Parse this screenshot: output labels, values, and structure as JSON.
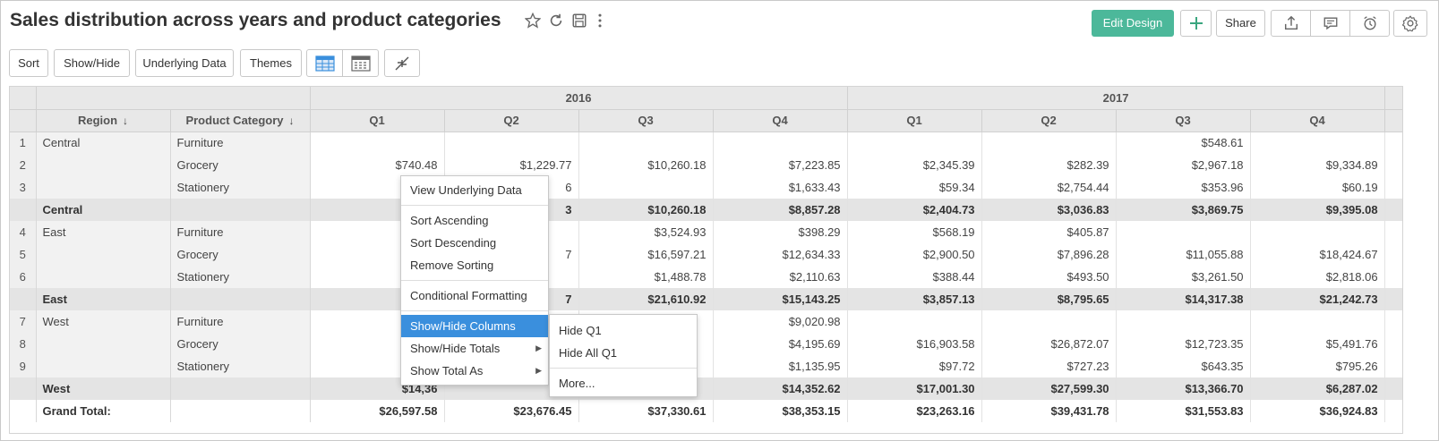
{
  "header": {
    "title": "Sales distribution across years and product categories",
    "edit_design": "Edit Design",
    "share": "Share"
  },
  "toolbar": {
    "sort": "Sort",
    "show_hide": "Show/Hide",
    "underlying_data": "Underlying Data",
    "themes": "Themes"
  },
  "table": {
    "years": [
      "2016",
      "2017"
    ],
    "dim_headers": [
      "Region",
      "Product Category"
    ],
    "quarters": [
      "Q1",
      "Q2",
      "Q3",
      "Q4",
      "Q1",
      "Q2",
      "Q3",
      "Q4"
    ],
    "rows": [
      {
        "idx": "1",
        "region": "Central",
        "category": "Furniture",
        "values": [
          "",
          "",
          "",
          "",
          "",
          "",
          "$548.61",
          ""
        ]
      },
      {
        "idx": "2",
        "region": "",
        "category": "Grocery",
        "values": [
          "$740.48",
          "$1,229.77",
          "$10,260.18",
          "$7,223.85",
          "$2,345.39",
          "$282.39",
          "$2,967.18",
          "$9,334.89"
        ]
      },
      {
        "idx": "3",
        "region": "",
        "category": "Stationery",
        "values": [
          "$79",
          "6",
          "",
          "$1,633.43",
          "$59.34",
          "$2,754.44",
          "$353.96",
          "$60.19"
        ]
      },
      {
        "sub": true,
        "region": "Central",
        "values": [
          "$1,53",
          "3",
          "$10,260.18",
          "$8,857.28",
          "$2,404.73",
          "$3,036.83",
          "$3,869.75",
          "$9,395.08"
        ]
      },
      {
        "idx": "4",
        "region": "East",
        "category": "Furniture",
        "values": [
          "$56",
          "",
          "$3,524.93",
          "$398.29",
          "$568.19",
          "$405.87",
          "",
          ""
        ]
      },
      {
        "idx": "5",
        "region": "",
        "category": "Grocery",
        "values": [
          "$9,22",
          "7",
          "$16,597.21",
          "$12,634.33",
          "$2,900.50",
          "$7,896.28",
          "$11,055.88",
          "$18,424.67"
        ]
      },
      {
        "idx": "6",
        "region": "",
        "category": "Stationery",
        "values": [
          "$89",
          "",
          "$1,488.78",
          "$2,110.63",
          "$388.44",
          "$493.50",
          "$3,261.50",
          "$2,818.06"
        ]
      },
      {
        "sub": true,
        "region": "East",
        "values": [
          "$10,69",
          "7",
          "$21,610.92",
          "$15,143.25",
          "$3,857.13",
          "$8,795.65",
          "$14,317.38",
          "$21,242.73"
        ]
      },
      {
        "idx": "7",
        "region": "West",
        "category": "Furniture",
        "values": [
          "$8,95",
          "",
          "",
          "$9,020.98",
          "",
          "",
          "",
          ""
        ]
      },
      {
        "idx": "8",
        "region": "",
        "category": "Grocery",
        "values": [
          "$4,87",
          "",
          "",
          "$4,195.69",
          "$16,903.58",
          "$26,872.07",
          "$12,723.35",
          "$5,491.76"
        ]
      },
      {
        "idx": "9",
        "region": "",
        "category": "Stationery",
        "values": [
          "$54",
          "",
          "",
          "$1,135.95",
          "$97.72",
          "$727.23",
          "$643.35",
          "$795.26"
        ]
      },
      {
        "sub": true,
        "region": "West",
        "values": [
          "$14,36",
          "",
          "",
          "$14,352.62",
          "$17,001.30",
          "$27,599.30",
          "$13,366.70",
          "$6,287.02"
        ]
      },
      {
        "grand": true,
        "region": "Grand Total:",
        "values": [
          "$26,597.58",
          "$23,676.45",
          "$37,330.61",
          "$38,353.15",
          "$23,263.16",
          "$39,431.78",
          "$31,553.83",
          "$36,924.83"
        ]
      }
    ]
  },
  "context_menu": {
    "items": [
      "View Underlying Data",
      "Sort Ascending",
      "Sort Descending",
      "Remove Sorting",
      "Conditional Formatting",
      "Show/Hide Columns",
      "Show/Hide Totals",
      "Show Total As"
    ]
  },
  "submenu": {
    "items": [
      "Hide Q1",
      "Hide All Q1",
      "More..."
    ]
  }
}
